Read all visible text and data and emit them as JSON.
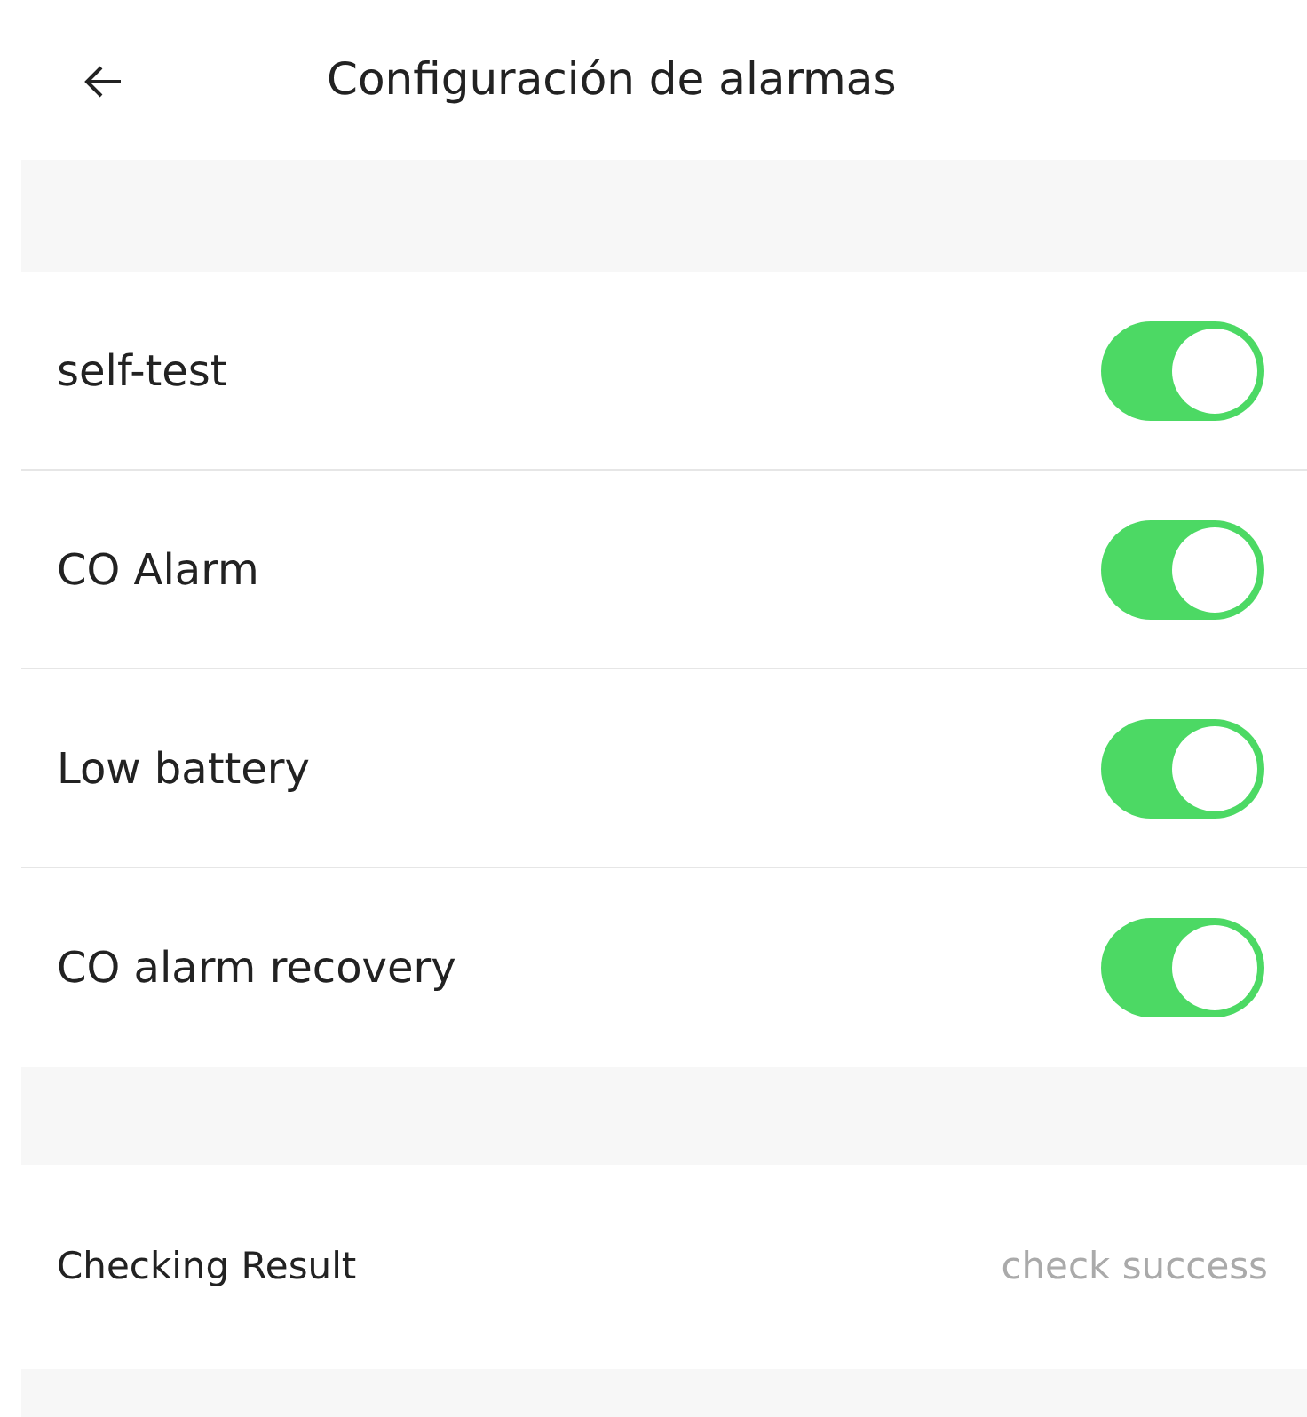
{
  "header": {
    "title": "Configuración de alarmas"
  },
  "settings": [
    {
      "label": "self-test",
      "on": true
    },
    {
      "label": "CO Alarm",
      "on": true
    },
    {
      "label": "Low battery",
      "on": true
    },
    {
      "label": "CO alarm recovery",
      "on": true
    }
  ],
  "result": {
    "label": "Checking Result",
    "value": "check success"
  }
}
